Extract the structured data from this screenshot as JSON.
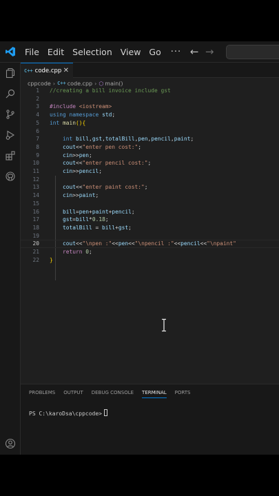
{
  "titlebar": {
    "menu": [
      "File",
      "Edit",
      "Selection",
      "View",
      "Go"
    ],
    "more": "···"
  },
  "tab": {
    "icon": "C++",
    "label": "code.cpp",
    "close": "✕"
  },
  "breadcrumb": {
    "folder": "cppcode",
    "file": "code.cpp",
    "function": "main()"
  },
  "editor": {
    "active_line": 20,
    "lines": [
      {
        "n": "1",
        "indent": 0,
        "tokens": [
          [
            "cmt",
            "//creating a bill invoice include gst"
          ]
        ]
      },
      {
        "n": "2",
        "indent": 0,
        "tokens": []
      },
      {
        "n": "3",
        "indent": 0,
        "tokens": [
          [
            "pp",
            "#include "
          ],
          [
            "str",
            "<iostream>"
          ]
        ]
      },
      {
        "n": "4",
        "indent": 0,
        "tokens": [
          [
            "kw",
            "using"
          ],
          [
            "pl",
            " "
          ],
          [
            "kw",
            "namespace"
          ],
          [
            "pl",
            " "
          ],
          [
            "var",
            "std"
          ],
          [
            "pl",
            ";"
          ]
        ]
      },
      {
        "n": "5",
        "indent": 0,
        "tokens": [
          [
            "kw",
            "int"
          ],
          [
            "pl",
            " "
          ],
          [
            "fn",
            "main"
          ],
          [
            "brk",
            "(){"
          ]
        ]
      },
      {
        "n": "6",
        "indent": 0,
        "tokens": []
      },
      {
        "n": "7",
        "indent": 1,
        "tokens": [
          [
            "kw",
            "int"
          ],
          [
            "pl",
            " "
          ],
          [
            "var",
            "bill"
          ],
          [
            "pl",
            ","
          ],
          [
            "var",
            "gst"
          ],
          [
            "pl",
            ","
          ],
          [
            "var",
            "totalBill"
          ],
          [
            "pl",
            ","
          ],
          [
            "var",
            "pen"
          ],
          [
            "pl",
            ","
          ],
          [
            "var",
            "pencil"
          ],
          [
            "pl",
            ","
          ],
          [
            "var",
            "paint"
          ],
          [
            "pl",
            ";"
          ]
        ]
      },
      {
        "n": "8",
        "indent": 1,
        "tokens": [
          [
            "var",
            "cout"
          ],
          [
            "pl",
            "<<"
          ],
          [
            "str",
            "\"enter pen cost:\""
          ],
          [
            "pl",
            ";"
          ]
        ]
      },
      {
        "n": "9",
        "indent": 1,
        "tokens": [
          [
            "var",
            "cin"
          ],
          [
            "pl",
            ">>"
          ],
          [
            "var",
            "pen"
          ],
          [
            "pl",
            ";"
          ]
        ]
      },
      {
        "n": "10",
        "indent": 1,
        "tokens": [
          [
            "var",
            "cout"
          ],
          [
            "pl",
            "<<"
          ],
          [
            "str",
            "\"enter pencil cost:\""
          ],
          [
            "pl",
            ";"
          ]
        ]
      },
      {
        "n": "11",
        "indent": 1,
        "tokens": [
          [
            "var",
            "cin"
          ],
          [
            "pl",
            ">>"
          ],
          [
            "var",
            "pencil"
          ],
          [
            "pl",
            ";"
          ]
        ]
      },
      {
        "n": "12",
        "indent": 1,
        "tokens": []
      },
      {
        "n": "13",
        "indent": 1,
        "tokens": [
          [
            "var",
            "cout"
          ],
          [
            "pl",
            "<<"
          ],
          [
            "str",
            "\"enter paint cost:\""
          ],
          [
            "pl",
            ";"
          ]
        ]
      },
      {
        "n": "14",
        "indent": 1,
        "tokens": [
          [
            "var",
            "cin"
          ],
          [
            "pl",
            ">>"
          ],
          [
            "var",
            "paint"
          ],
          [
            "pl",
            ";"
          ]
        ]
      },
      {
        "n": "15",
        "indent": 1,
        "tokens": []
      },
      {
        "n": "16",
        "indent": 1,
        "tokens": [
          [
            "var",
            "bill"
          ],
          [
            "pl",
            "="
          ],
          [
            "var",
            "pen"
          ],
          [
            "pl",
            "+"
          ],
          [
            "var",
            "paint"
          ],
          [
            "pl",
            "+"
          ],
          [
            "var",
            "pencil"
          ],
          [
            "pl",
            ";"
          ]
        ]
      },
      {
        "n": "17",
        "indent": 1,
        "tokens": [
          [
            "var",
            "gst"
          ],
          [
            "pl",
            "="
          ],
          [
            "var",
            "bill"
          ],
          [
            "pl",
            "*"
          ],
          [
            "num",
            "0.18"
          ],
          [
            "pl",
            ";"
          ]
        ]
      },
      {
        "n": "18",
        "indent": 1,
        "tokens": [
          [
            "var",
            "totalBill"
          ],
          [
            "pl",
            " = "
          ],
          [
            "var",
            "bill"
          ],
          [
            "pl",
            "+"
          ],
          [
            "var",
            "gst"
          ],
          [
            "pl",
            ";"
          ]
        ]
      },
      {
        "n": "19",
        "indent": 1,
        "tokens": []
      },
      {
        "n": "20",
        "indent": 1,
        "tokens": [
          [
            "var",
            "cout"
          ],
          [
            "pl",
            "<<"
          ],
          [
            "str",
            "\"\\npen :\""
          ],
          [
            "pl",
            "<<"
          ],
          [
            "var",
            "pen"
          ],
          [
            "pl",
            "<<"
          ],
          [
            "str",
            "\"\\npencil :\""
          ],
          [
            "pl",
            "<<"
          ],
          [
            "var",
            "pencil"
          ],
          [
            "pl",
            "<<"
          ],
          [
            "str",
            "\"\\npaint\""
          ]
        ]
      },
      {
        "n": "21",
        "indent": 1,
        "tokens": [
          [
            "pp",
            "return"
          ],
          [
            "pl",
            " "
          ],
          [
            "num",
            "0"
          ],
          [
            "pl",
            ";"
          ]
        ]
      },
      {
        "n": "22",
        "indent": 0,
        "tokens": [
          [
            "brk",
            "}"
          ]
        ]
      }
    ]
  },
  "panel": {
    "tabs": [
      "PROBLEMS",
      "OUTPUT",
      "DEBUG CONSOLE",
      "TERMINAL",
      "PORTS"
    ],
    "active_tab": 3,
    "prompt": "PS C:\\karoDsa\\cppcode>"
  },
  "icons": {
    "accent": "#0078d4",
    "activity": [
      "explorer-icon",
      "search-icon",
      "source-control-icon",
      "run-debug-icon",
      "extensions-icon",
      "github-icon",
      "account-icon",
      "settings-gear-icon"
    ]
  }
}
